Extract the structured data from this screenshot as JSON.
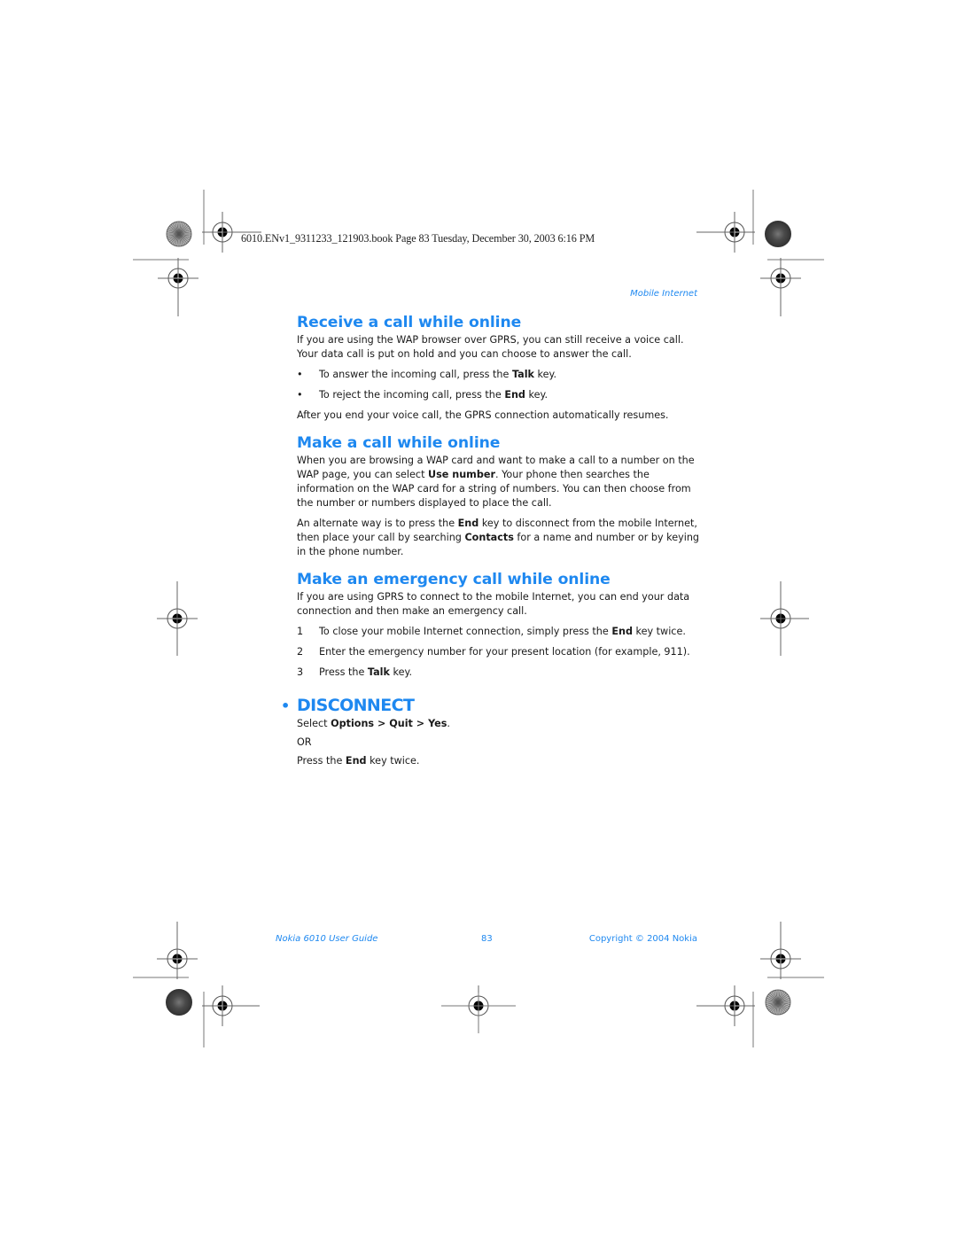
{
  "slug_line": "6010.ENv1_9311233_121903.book  Page 83  Tuesday, December 30, 2003  6:16 PM",
  "running_head": "Mobile Internet",
  "sections": {
    "receive": {
      "title": "Receive a call while online",
      "intro": "If you are using the WAP browser over GPRS, you can still receive a voice call. Your data call is put on hold and you can choose to answer the call.",
      "bullets": [
        {
          "pre": "To answer the incoming call, press the ",
          "bold": "Talk",
          "post": " key."
        },
        {
          "pre": "To reject the incoming call, press the ",
          "bold": "End",
          "post": " key."
        }
      ],
      "outro": "After you end your voice call, the GPRS connection automatically resumes."
    },
    "make": {
      "title": "Make a call while online",
      "p1_pre": "When you are browsing a WAP card and want to make a call to a number on the WAP page, you can select ",
      "p1_bold": "Use number",
      "p1_post": ". Your phone then searches the information on the WAP card for a string of numbers.  You can then choose from the number or numbers displayed to place the call.",
      "p2_pre": "An alternate way is to press the ",
      "p2_bold1": "End",
      "p2_mid": " key to disconnect from the mobile Internet, then place your call by searching ",
      "p2_bold2": "Contacts",
      "p2_post": " for a name and number or by keying in the phone number."
    },
    "emergency": {
      "title": "Make an emergency call while online",
      "intro": "If you are using GPRS to connect to the mobile Internet, you can end your data connection and then make an emergency call.",
      "steps": [
        {
          "num": "1",
          "pre": "To close your mobile Internet connection, simply press the ",
          "bold": "End",
          "post": " key twice."
        },
        {
          "num": "2",
          "pre": "Enter the emergency number for your present location (for example, 911).",
          "bold": "",
          "post": ""
        },
        {
          "num": "3",
          "pre": "Press the ",
          "bold": "Talk",
          "post": " key."
        }
      ]
    },
    "disconnect": {
      "bullet": "•",
      "title": "DISCONNECT",
      "line1_pre": "Select ",
      "line1_bold": "Options > Quit > Yes",
      "line1_post": ".",
      "or": "OR",
      "line2_pre": "Press the ",
      "line2_bold": "End",
      "line2_post": " key twice."
    }
  },
  "footer": {
    "left": "Nokia 6010 User Guide",
    "page": "83",
    "right": "Copyright © 2004 Nokia"
  },
  "colors": {
    "accent": "#1e88f0",
    "text": "#1a1a1a",
    "marks": "#555555"
  },
  "bullet_glyph": "•"
}
